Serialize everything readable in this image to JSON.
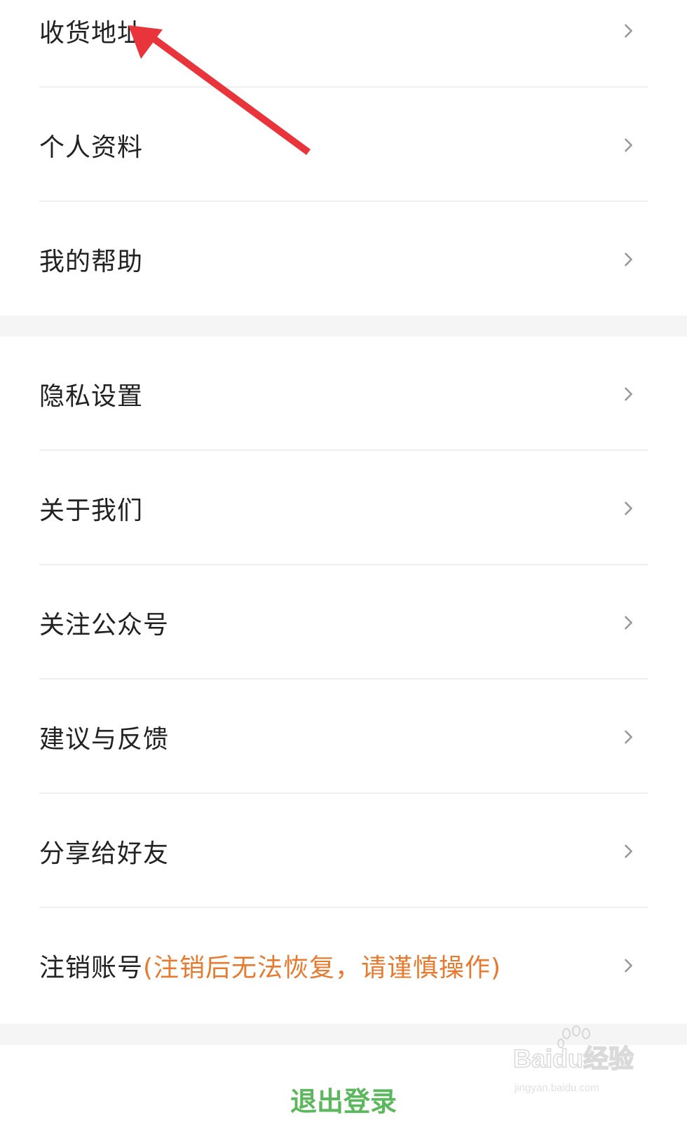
{
  "menu_group_1": [
    {
      "label": "收货地址"
    },
    {
      "label": "个人资料"
    },
    {
      "label": "我的帮助"
    }
  ],
  "menu_group_2": [
    {
      "label": "隐私设置"
    },
    {
      "label": "关于我们"
    },
    {
      "label": "关注公众号"
    },
    {
      "label": "建议与反馈"
    },
    {
      "label": "分享给好友"
    },
    {
      "label": "注销账号",
      "note": "(注销后无法恢复，请谨慎操作)"
    }
  ],
  "logout": {
    "label": "退出登录"
  },
  "watermark": {
    "brand": "Baidu经验",
    "site": "jingyan.baidu.com"
  },
  "colors": {
    "accent_green": "#5cb85c",
    "warning_orange": "#e87a2f",
    "annotation_red": "#e8343a"
  }
}
